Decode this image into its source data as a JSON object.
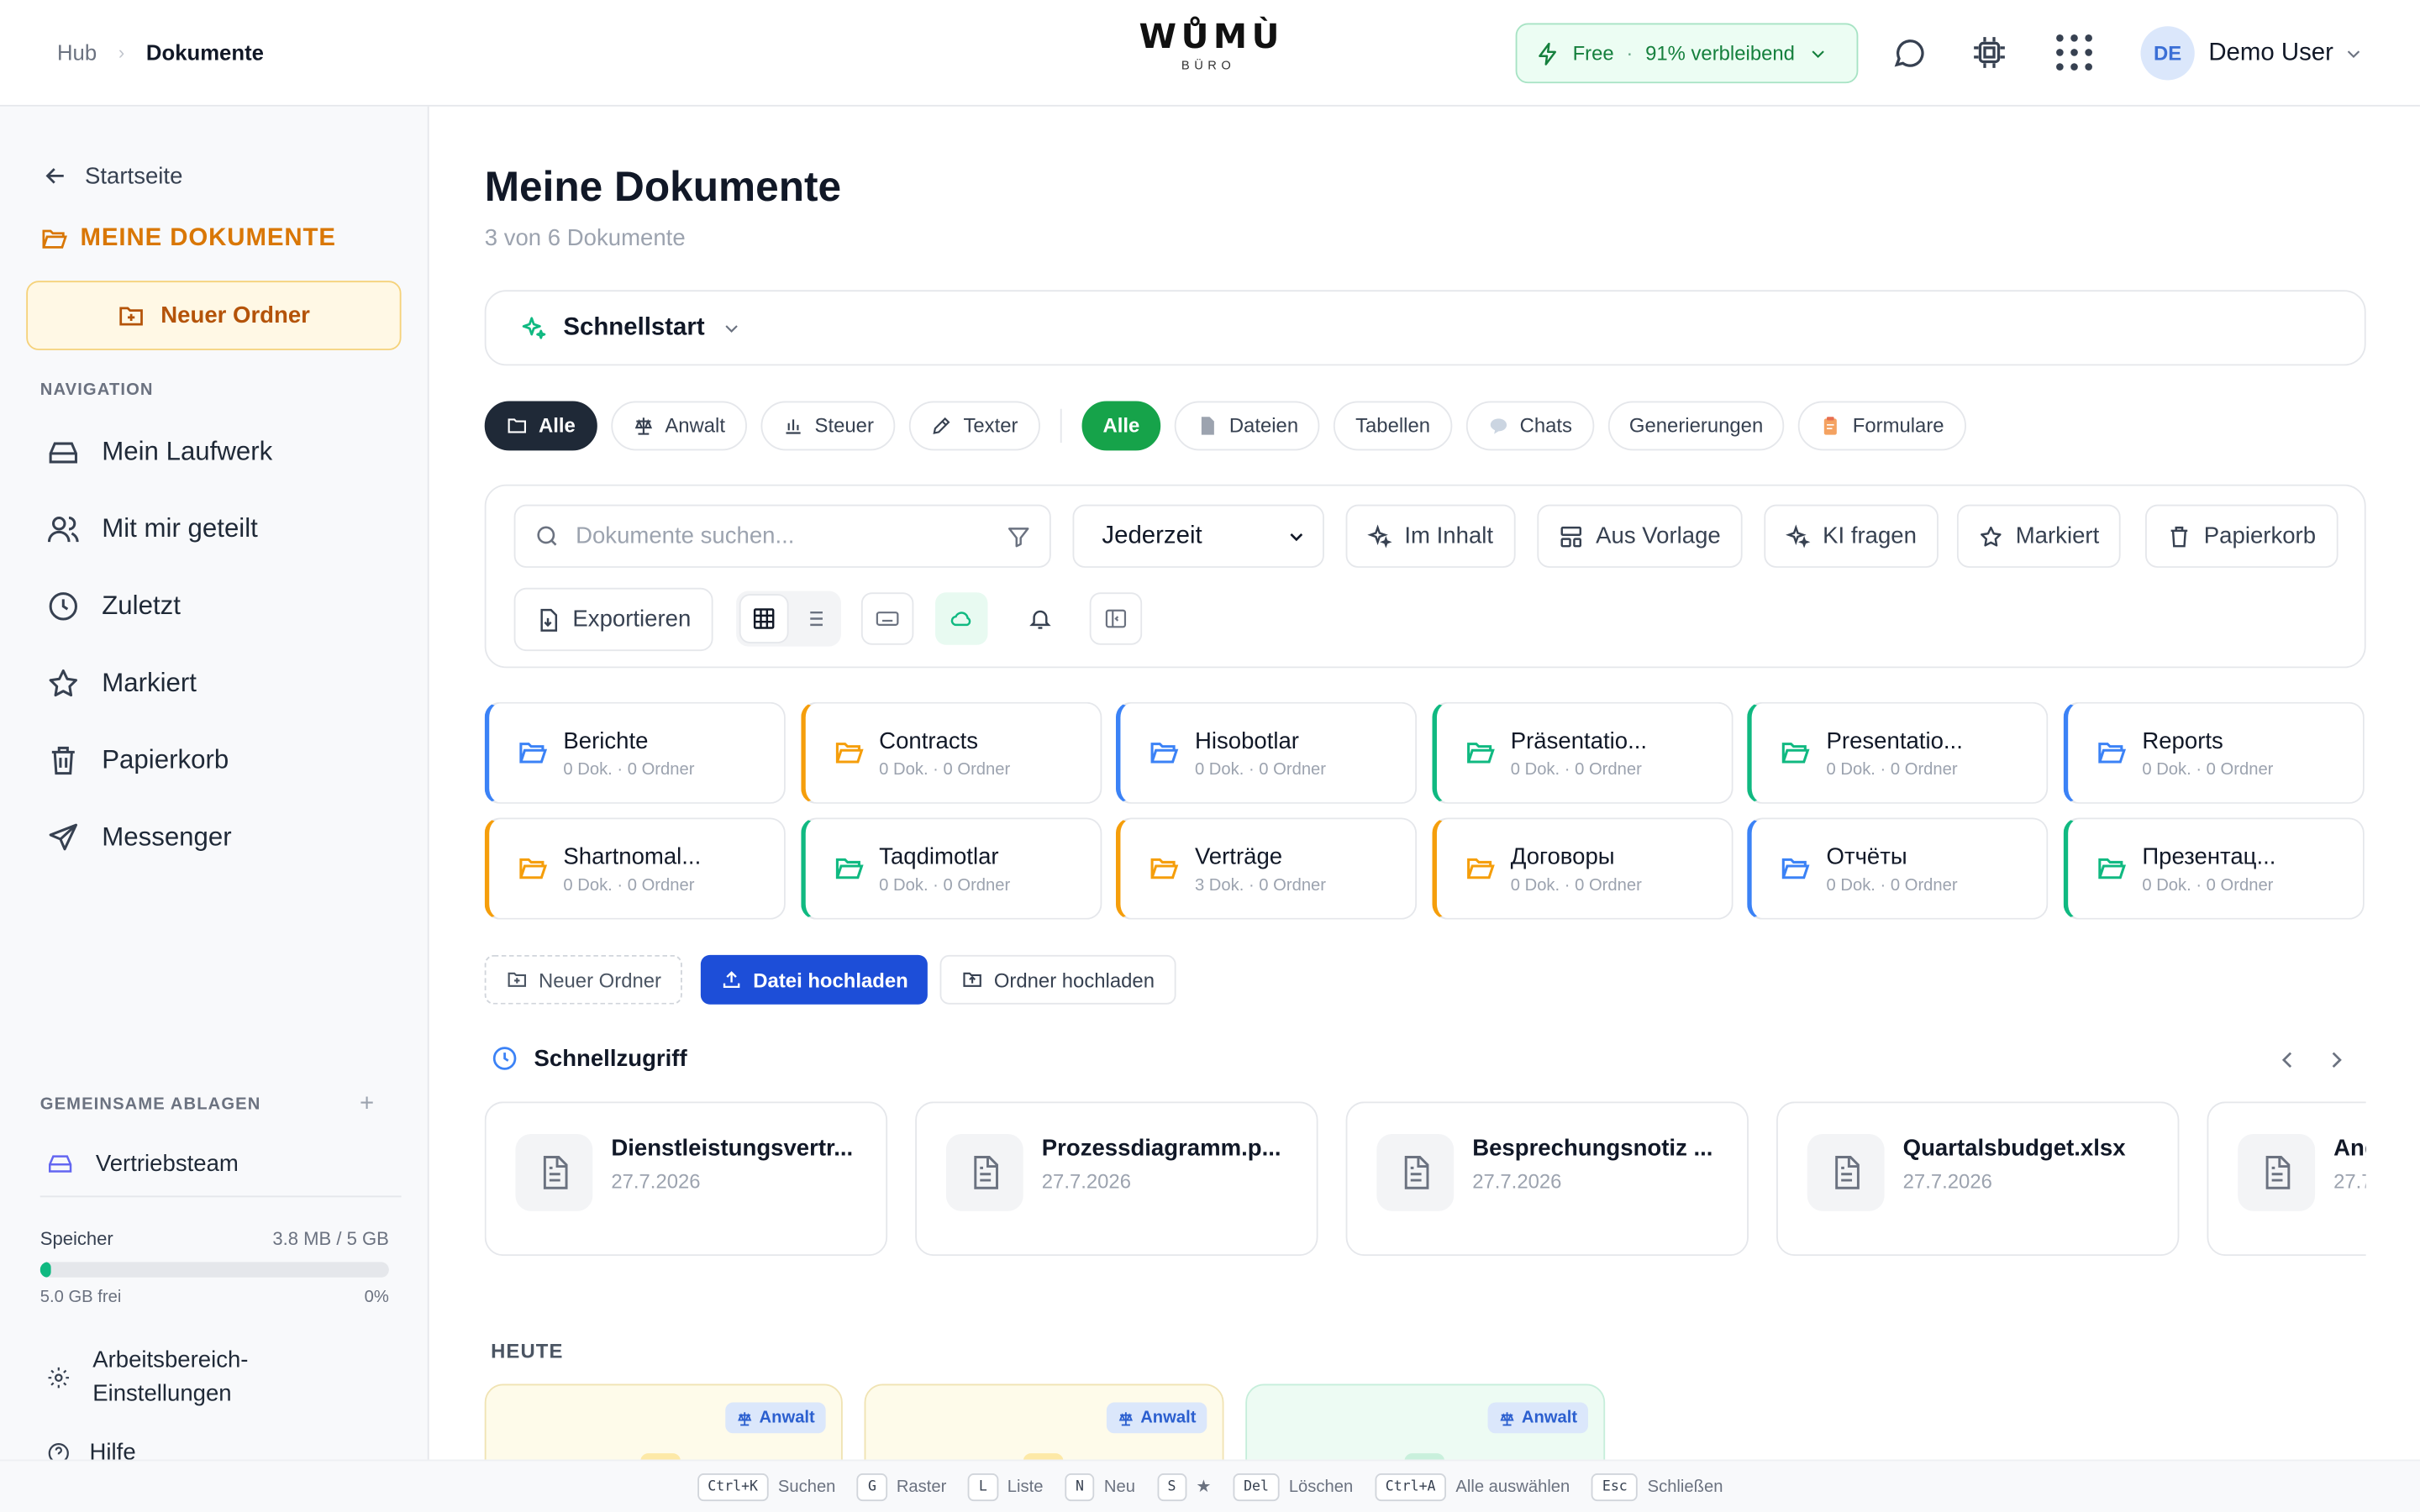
{
  "header": {
    "breadcrumb": [
      "Hub",
      "Dokumente"
    ],
    "logo": "WŮMÙ",
    "logo_sub": "BÜRO",
    "plan_name": "Free",
    "plan_remaining": "91% verbleibend",
    "user_initials": "DE",
    "user_name": "Demo User"
  },
  "sidebar": {
    "back_label": "Startseite",
    "section_title": "MEINE DOKUMENTE",
    "new_folder_label": "Neuer Ordner",
    "nav_label": "NAVIGATION",
    "nav_items": [
      "Mein Laufwerk",
      "Mit mir geteilt",
      "Zuletzt",
      "Markiert",
      "Papierkorb",
      "Messenger"
    ],
    "shared_label": "GEMEINSAME ABLAGEN",
    "shared_items": [
      "Vertriebsteam"
    ],
    "storage_label": "Speicher",
    "storage_used": "3.8 MB / 5 GB",
    "storage_fraction": 0.03,
    "storage_free": "5.0 GB frei",
    "storage_percent": "0%",
    "workspace_settings": "Arbeitsbereich-Einstellungen",
    "help": "Hilfe"
  },
  "main": {
    "title": "Meine Dokumente",
    "subtitle": "3 von 6 Dokumente",
    "quickstart": "Schnellstart",
    "category_chips": [
      "Alle",
      "Anwalt",
      "Steuer",
      "Texter"
    ],
    "type_chips": [
      "Alle",
      "Dateien",
      "Tabellen",
      "Chats",
      "Generierungen",
      "Formulare"
    ],
    "search_placeholder": "Dokumente suchen...",
    "time_filter": "Jederzeit",
    "toolbar_buttons": [
      "Im Inhalt",
      "Aus Vorlage",
      "KI fragen",
      "Markiert",
      "Papierkorb"
    ],
    "export_label": "Exportieren",
    "folders": [
      {
        "name": "Berichte",
        "meta": "0 Dok. · 0 Ordner",
        "color": "#3b82f6"
      },
      {
        "name": "Contracts",
        "meta": "0 Dok. · 0 Ordner",
        "color": "#f59e0b"
      },
      {
        "name": "Hisobotlar",
        "meta": "0 Dok. · 0 Ordner",
        "color": "#3b82f6"
      },
      {
        "name": "Präsentatio...",
        "meta": "0 Dok. · 0 Ordner",
        "color": "#10b981"
      },
      {
        "name": "Presentatio...",
        "meta": "0 Dok. · 0 Ordner",
        "color": "#10b981"
      },
      {
        "name": "Reports",
        "meta": "0 Dok. · 0 Ordner",
        "color": "#3b82f6"
      },
      {
        "name": "Shartnomal...",
        "meta": "0 Dok. · 0 Ordner",
        "color": "#f59e0b"
      },
      {
        "name": "Taqdimotlar",
        "meta": "0 Dok. · 0 Ordner",
        "color": "#10b981"
      },
      {
        "name": "Verträge",
        "meta": "3 Dok. · 0 Ordner",
        "color": "#f59e0b"
      },
      {
        "name": "Договоры",
        "meta": "0 Dok. · 0 Ordner",
        "color": "#f59e0b"
      },
      {
        "name": "Отчёты",
        "meta": "0 Dok. · 0 Ordner",
        "color": "#3b82f6"
      },
      {
        "name": "Презентац...",
        "meta": "0 Dok. · 0 Ordner",
        "color": "#10b981"
      }
    ],
    "new_folder": "Neuer Ordner",
    "upload_file": "Datei hochladen",
    "upload_folder": "Ordner hochladen",
    "quick_access_title": "Schnellzugriff",
    "quick_access": [
      {
        "name": "Dienstleistungsvertr...",
        "date": "27.7.2026"
      },
      {
        "name": "Prozessdiagramm.p...",
        "date": "27.7.2026"
      },
      {
        "name": "Besprechungsnotiz ...",
        "date": "27.7.2026"
      },
      {
        "name": "Quartalsbudget.xlsx",
        "date": "27.7.2026"
      },
      {
        "name": "Ang",
        "date": "27.7."
      }
    ],
    "today_label": "HEUTE",
    "today_badge": "Anwalt"
  },
  "shortcuts": [
    {
      "key": "Ctrl+K",
      "label": "Suchen"
    },
    {
      "key": "G",
      "label": "Raster"
    },
    {
      "key": "L",
      "label": "Liste"
    },
    {
      "key": "N",
      "label": "Neu"
    },
    {
      "key": "S",
      "label": "★"
    },
    {
      "key": "Del",
      "label": "Löschen"
    },
    {
      "key": "Ctrl+A",
      "label": "Alle auswählen"
    },
    {
      "key": "Esc",
      "label": "Schließen"
    }
  ],
  "colors": {
    "accent_green": "#16a34a",
    "accent_orange": "#d97706",
    "primary_blue": "#1d4ed8"
  }
}
